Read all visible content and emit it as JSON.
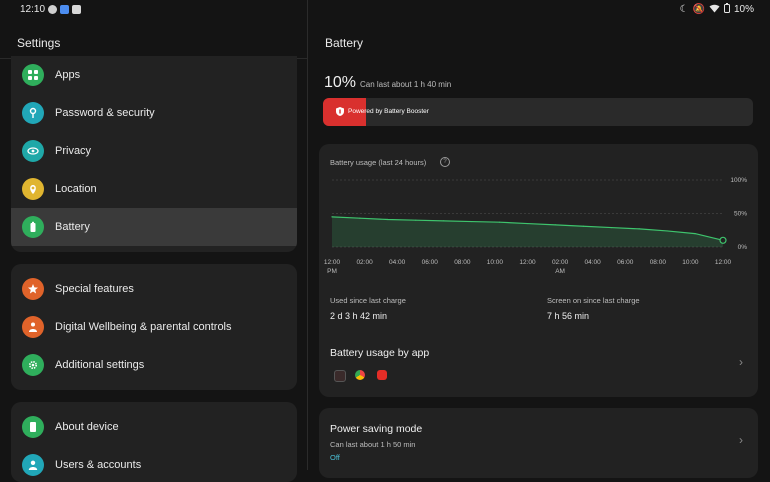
{
  "status_bar": {
    "time": "12:10",
    "battery_percent": "10%"
  },
  "settings_pane": {
    "title": "Settings",
    "group1": [
      {
        "label": "Apps",
        "icon": "apps-icon",
        "color": "#2fae5c"
      },
      {
        "label": "Password & security",
        "icon": "key-icon",
        "color": "#21a7b8"
      },
      {
        "label": "Privacy",
        "icon": "privacy-icon",
        "color": "#1fa8a8"
      },
      {
        "label": "Location",
        "icon": "location-icon",
        "color": "#e0b530"
      },
      {
        "label": "Battery",
        "icon": "battery-icon",
        "color": "#2fae5c",
        "active": true
      }
    ],
    "group2": [
      {
        "label": "Special features",
        "icon": "star-icon",
        "color": "#e0632a"
      },
      {
        "label": "Digital Wellbeing & parental controls",
        "icon": "wellbeing-icon",
        "color": "#e0632a"
      },
      {
        "label": "Additional settings",
        "icon": "gear-icon",
        "color": "#2fae5c"
      }
    ],
    "group3": [
      {
        "label": "About device",
        "icon": "device-icon",
        "color": "#2fae5c"
      },
      {
        "label": "Users & accounts",
        "icon": "user-icon",
        "color": "#21a7b8"
      }
    ]
  },
  "battery_pane": {
    "title": "Battery",
    "level": "10%",
    "level_fraction": 0.1,
    "estimate": "Can last about 1 h 40 min",
    "booster_label": "Powered by Battery Booster",
    "usage_card": {
      "title": "Battery usage (last 24 hours)",
      "used_since_label": "Used since last charge",
      "used_since_value": "2 d 3 h 42 min",
      "screen_on_label": "Screen on since last charge",
      "screen_on_value": "7 h 56 min",
      "by_app_title": "Battery usage by app"
    },
    "power_saving": {
      "title": "Power saving mode",
      "subtitle": "Can last about 1 h 50 min",
      "state": "Off"
    }
  },
  "chart_data": {
    "type": "area",
    "x": [
      "12:00 PM",
      "02:00",
      "04:00",
      "06:00",
      "08:00",
      "10:00",
      "12:00 AM",
      "02:00",
      "04:00",
      "06:00",
      "08:00",
      "10:00",
      "12:00"
    ],
    "x_ticks": [
      {
        "top": "12:00",
        "bottom": "PM"
      },
      {
        "top": "02:00",
        "bottom": ""
      },
      {
        "top": "04:00",
        "bottom": ""
      },
      {
        "top": "06:00",
        "bottom": ""
      },
      {
        "top": "08:00",
        "bottom": ""
      },
      {
        "top": "10:00",
        "bottom": ""
      },
      {
        "top": "12:00",
        "bottom": ""
      },
      {
        "top": "02:00",
        "bottom": "AM"
      },
      {
        "top": "04:00",
        "bottom": ""
      },
      {
        "top": "06:00",
        "bottom": ""
      },
      {
        "top": "08:00",
        "bottom": ""
      },
      {
        "top": "10:00",
        "bottom": ""
      },
      {
        "top": "12:00",
        "bottom": ""
      }
    ],
    "y_ticks": [
      "100%",
      "50%",
      "0%"
    ],
    "series": [
      {
        "values": [
          45,
          43,
          41,
          40,
          39,
          38,
          37,
          35,
          33,
          31,
          29,
          27,
          24,
          20,
          10
        ]
      }
    ],
    "ylim": [
      0,
      100
    ],
    "line_color": "#3ec46d"
  }
}
